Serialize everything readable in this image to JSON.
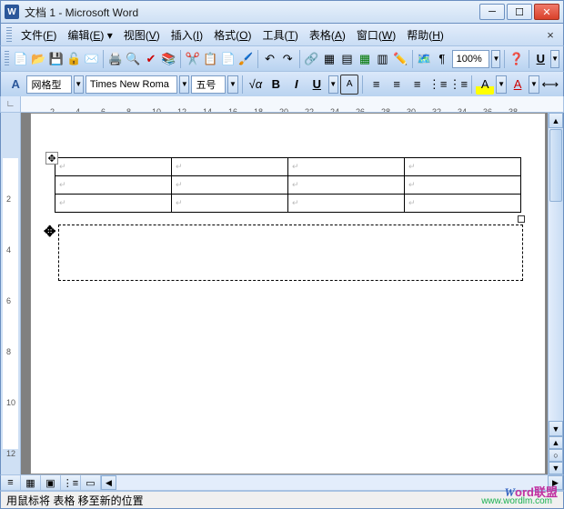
{
  "window": {
    "title": "文档 1 - Microsoft Word",
    "app_icon_text": "W"
  },
  "menu": {
    "items": [
      {
        "label": "文件",
        "key": "F"
      },
      {
        "label": "编辑",
        "key": "E"
      },
      {
        "label": "视图",
        "key": "V"
      },
      {
        "label": "插入",
        "key": "I"
      },
      {
        "label": "格式",
        "key": "O"
      },
      {
        "label": "工具",
        "key": "T"
      },
      {
        "label": "表格",
        "key": "A"
      },
      {
        "label": "窗口",
        "key": "W"
      },
      {
        "label": "帮助",
        "key": "H"
      }
    ]
  },
  "toolbar1": {
    "zoom": "100%"
  },
  "format": {
    "style_icon": "A",
    "style": "网格型",
    "font": "Times New Roma",
    "size": "五号"
  },
  "ruler": {
    "h_numbers": [
      "2",
      "4",
      "6",
      "8",
      "10",
      "12",
      "14",
      "16",
      "18",
      "20",
      "22",
      "24",
      "26",
      "28",
      "30",
      "32",
      "34",
      "36",
      "38"
    ],
    "v_numbers": [
      "2",
      "4",
      "6",
      "8",
      "10",
      "12"
    ]
  },
  "doc": {
    "table": {
      "rows": 3,
      "cols": 4
    }
  },
  "status": {
    "message": "用鼠标将 表格 移至新的位置",
    "brand_prefix": "W",
    "brand_suffix": "ord联盟",
    "url": "www.wordlm.com"
  }
}
